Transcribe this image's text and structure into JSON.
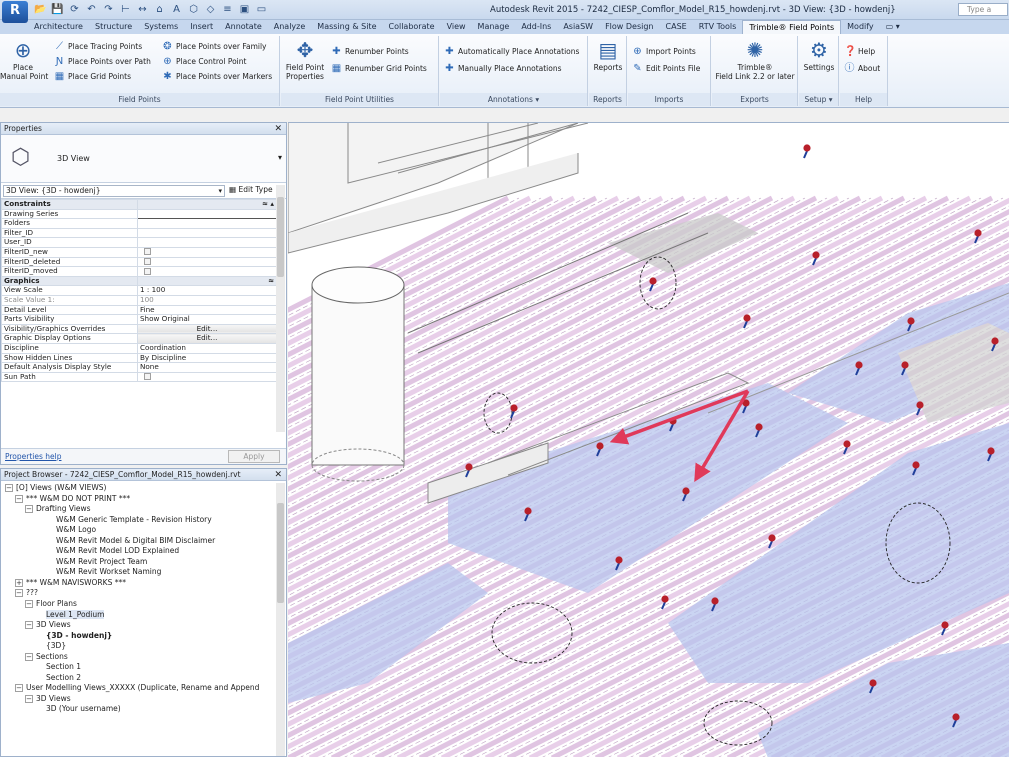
{
  "app": {
    "button_label": "R",
    "title": "Autodesk Revit 2015 -   7242_CIESP_Comflor_Model_R15_howdenj.rvt - 3D View: {3D - howdenj}",
    "search_placeholder": "Type a"
  },
  "quick_access": [
    "open-icon",
    "save-icon",
    "sync-icon",
    "undo-icon",
    "redo-icon",
    "measure-icon",
    "dimension-icon",
    "tag-icon",
    "text-icon",
    "default-3d-icon",
    "section-icon",
    "thin-lines-icon",
    "close-windows-icon",
    "switch-windows-icon"
  ],
  "tabs": [
    {
      "label": "Architecture"
    },
    {
      "label": "Structure"
    },
    {
      "label": "Systems"
    },
    {
      "label": "Insert"
    },
    {
      "label": "Annotate"
    },
    {
      "label": "Analyze"
    },
    {
      "label": "Massing & Site"
    },
    {
      "label": "Collaborate"
    },
    {
      "label": "View"
    },
    {
      "label": "Manage"
    },
    {
      "label": "Add-Ins"
    },
    {
      "label": "AsiaSW"
    },
    {
      "label": "Flow Design"
    },
    {
      "label": "CASE"
    },
    {
      "label": "RTV Tools"
    },
    {
      "label": "Trimble® Field Points",
      "active": true
    },
    {
      "label": "Modify"
    },
    {
      "label": "▭ ▾"
    }
  ],
  "ribbon": {
    "field_points": {
      "title": "Field Points",
      "place_manual_point": "Place\nManual Point",
      "place_tracing_points": "Place Tracing Points",
      "place_points_over_path": "Place Points over Path",
      "place_grid_points": "Place Grid Points",
      "place_points_over_family": "Place Points over Family",
      "place_control_point": "Place Control Point",
      "place_points_over_markers": "Place Points over Markers"
    },
    "field_point_utilities": {
      "title": "Field Point Utilities",
      "field_point_properties": "Field Point\nProperties",
      "renumber_points": "Renumber Points",
      "renumber_grid_points": "Renumber Grid Points"
    },
    "annotations": {
      "title": "Annotations ▾",
      "auto_place": "Automatically Place Annotations",
      "manual_place": "Manually Place Annotations"
    },
    "reports": {
      "title": "Reports",
      "button": "Reports"
    },
    "imports": {
      "title": "Imports",
      "import_points": "Import Points",
      "edit_points_file": "Edit Points File"
    },
    "exports": {
      "title": "Exports",
      "button": "Trimble®\nField Link 2.2 or later"
    },
    "setup": {
      "title": "Setup ▾",
      "button": "Settings"
    },
    "help": {
      "title": "Help",
      "help": "Help",
      "about": "About"
    }
  },
  "properties": {
    "title": "Properties",
    "type_name": "3D View",
    "instance": "3D View: {3D - howdenj}",
    "edit_type": "Edit Type",
    "rows": [
      {
        "k": "Constraints",
        "group": true,
        "v": "≈ ▴"
      },
      {
        "k": "Drawing Series",
        "v": "",
        "input": true
      },
      {
        "k": "Folders",
        "v": ""
      },
      {
        "k": "Filter_ID",
        "v": ""
      },
      {
        "k": "User_ID",
        "v": ""
      },
      {
        "k": "FilterID_new",
        "v": "",
        "check": true
      },
      {
        "k": "FilterID_deleted",
        "v": "",
        "check": true
      },
      {
        "k": "FilterID_moved",
        "v": "",
        "check": true
      },
      {
        "k": "Graphics",
        "group": true,
        "v": "≈"
      },
      {
        "k": "View Scale",
        "v": "1 : 100"
      },
      {
        "k": "Scale Value    1:",
        "v": "100",
        "dim": true
      },
      {
        "k": "Detail Level",
        "v": "Fine"
      },
      {
        "k": "Parts Visibility",
        "v": "Show Original"
      },
      {
        "k": "Visibility/Graphics Overrides",
        "v": "Edit...",
        "btn": true
      },
      {
        "k": "Graphic Display Options",
        "v": "Edit...",
        "btn": true
      },
      {
        "k": "Discipline",
        "v": "Coordination"
      },
      {
        "k": "Show Hidden Lines",
        "v": "By Discipline"
      },
      {
        "k": "Default Analysis Display Style",
        "v": "None"
      },
      {
        "k": "Sun Path",
        "v": "",
        "check": true
      }
    ],
    "help_link": "Properties help",
    "apply": "Apply"
  },
  "browser": {
    "title": "Project Browser - 7242_CIESP_Comflor_Model_R15_howdenj.rvt",
    "nodes": [
      {
        "d": 0,
        "tg": "−",
        "t": "[O] Views (W&M VIEWS)"
      },
      {
        "d": 1,
        "tg": "−",
        "t": "*** W&M DO NOT PRINT ***"
      },
      {
        "d": 2,
        "tg": "−",
        "t": "Drafting Views"
      },
      {
        "d": 4,
        "t": "W&M Generic Template - Revision History"
      },
      {
        "d": 4,
        "t": "W&M Logo"
      },
      {
        "d": 4,
        "t": "W&M Revit Model & Digital BIM Disclaimer"
      },
      {
        "d": 4,
        "t": "W&M Revit Model LOD Explained"
      },
      {
        "d": 4,
        "t": "W&M Revit Project Team"
      },
      {
        "d": 4,
        "t": "W&M Revit Workset Naming"
      },
      {
        "d": 1,
        "tg": "+",
        "t": "*** W&M NAVISWORKS ***"
      },
      {
        "d": 1,
        "tg": "−",
        "t": "???"
      },
      {
        "d": 2,
        "tg": "−",
        "t": "Floor Plans"
      },
      {
        "d": 3,
        "t": "Level 1_Podium",
        "hi": true
      },
      {
        "d": 2,
        "tg": "−",
        "t": "3D Views"
      },
      {
        "d": 3,
        "t": "{3D - howdenj}",
        "sel": true
      },
      {
        "d": 3,
        "t": "{3D}"
      },
      {
        "d": 2,
        "tg": "−",
        "t": "Sections"
      },
      {
        "d": 3,
        "t": "Section 1"
      },
      {
        "d": 3,
        "t": "Section 2"
      },
      {
        "d": 1,
        "tg": "−",
        "t": "User Modelling Views_XXXXX (Duplicate, Rename and Append"
      },
      {
        "d": 2,
        "tg": "−",
        "t": "3D Views"
      },
      {
        "d": 3,
        "t": "3D (Your username)"
      }
    ]
  },
  "viewport": {
    "colors": {
      "deck": "#d6a8d8",
      "slab": "#b9c6ee",
      "pin": "#b8202a",
      "arrow": "#e0395a",
      "ghost": "#c7c7c7"
    }
  }
}
